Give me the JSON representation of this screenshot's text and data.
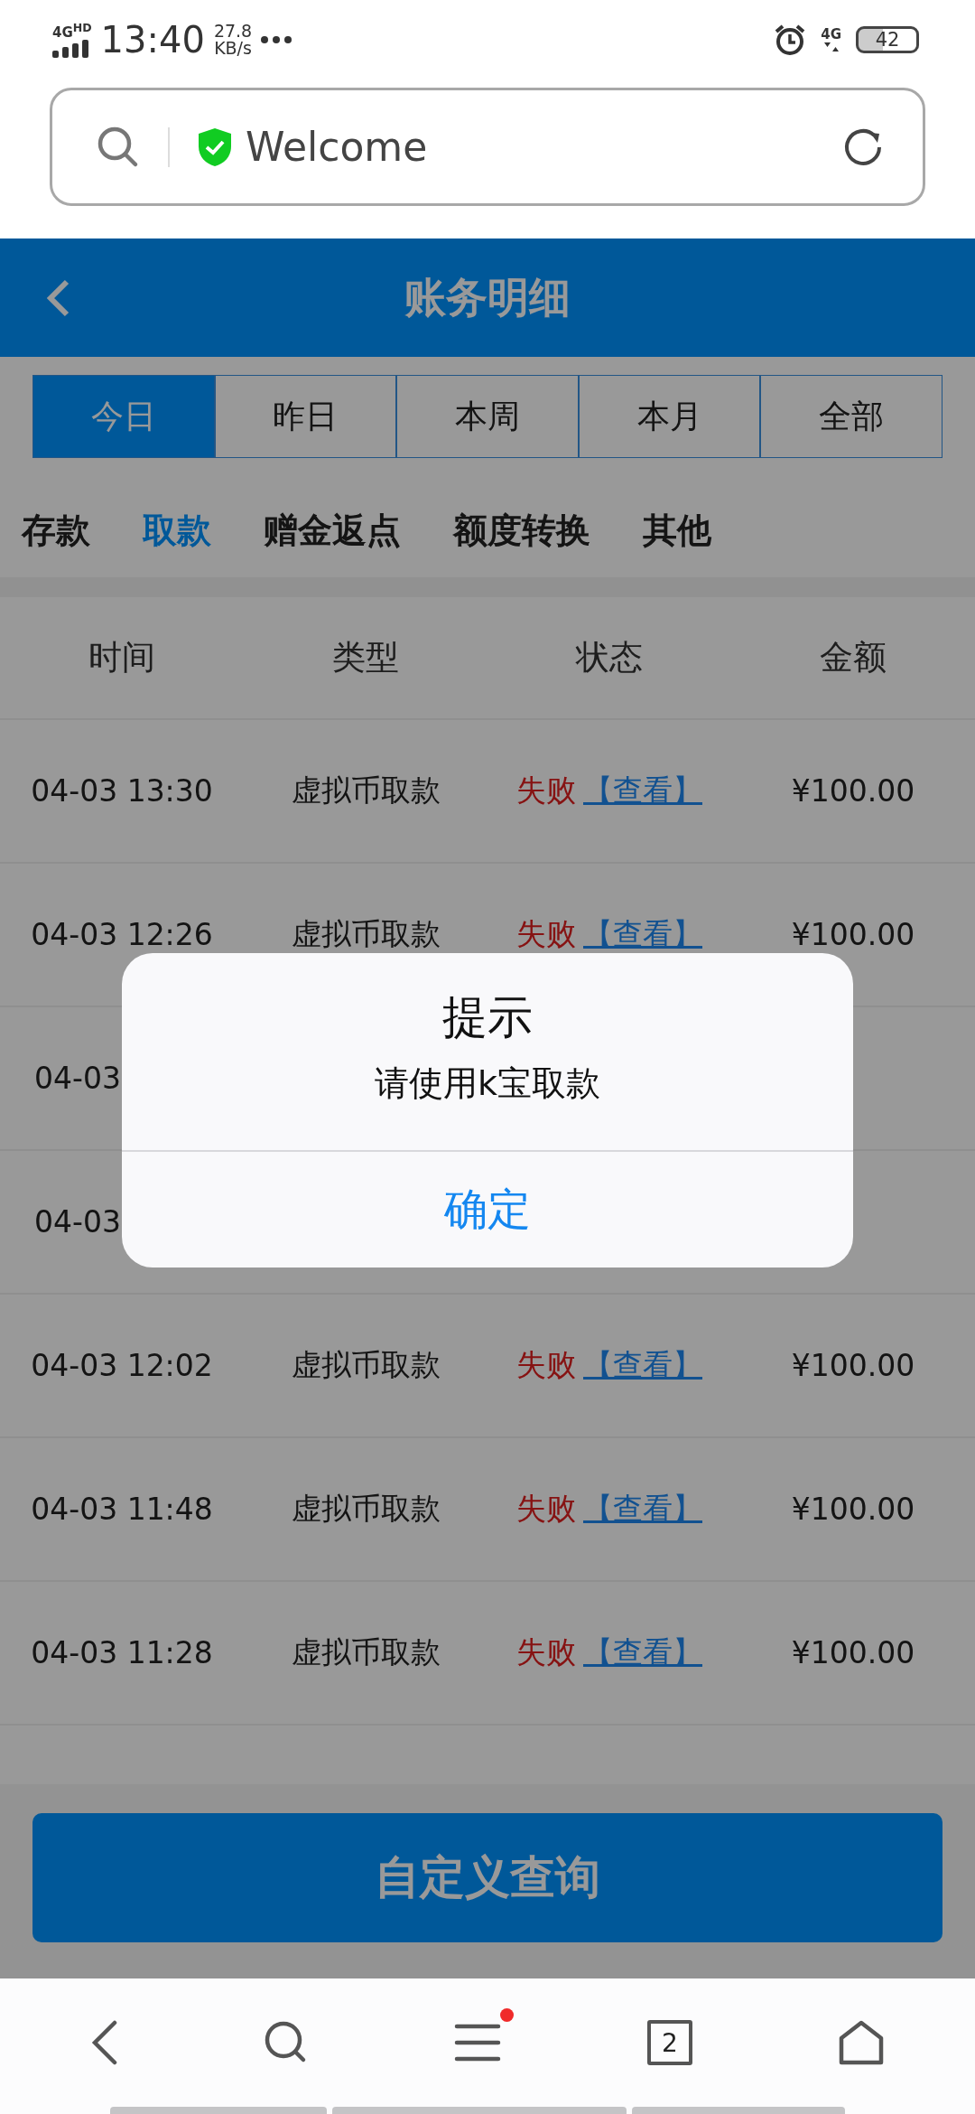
{
  "status_bar": {
    "network": "4G",
    "network_badge": "HD",
    "time": "13:40",
    "speed": "27.8",
    "speed_unit": "KB/s",
    "network_right": "4G",
    "battery": "42"
  },
  "address_bar": {
    "text": "Welcome"
  },
  "header": {
    "title": "账务明细"
  },
  "period_tabs": [
    {
      "label": "今日",
      "selected": true
    },
    {
      "label": "昨日",
      "selected": false
    },
    {
      "label": "本周",
      "selected": false
    },
    {
      "label": "本月",
      "selected": false
    },
    {
      "label": "全部",
      "selected": false
    }
  ],
  "category_tabs": [
    {
      "label": "存款",
      "selected": false
    },
    {
      "label": "取款",
      "selected": true
    },
    {
      "label": "赠金返点",
      "selected": false
    },
    {
      "label": "额度转换",
      "selected": false
    },
    {
      "label": "其他",
      "selected": false
    }
  ],
  "table": {
    "columns": [
      "时间",
      "类型",
      "状态",
      "金额"
    ],
    "rows": [
      {
        "time": "04-03 13:30",
        "type": "虚拟币取款",
        "status": "失败",
        "link": "【查看】",
        "amount": "¥100.00"
      },
      {
        "time": "04-03 12:26",
        "type": "虚拟币取款",
        "status": "失败",
        "link": "【查看】",
        "amount": "¥100.00"
      },
      {
        "time": "04-03"
      },
      {
        "time": "04-03"
      },
      {
        "time": "04-03 12:02",
        "type": "虚拟币取款",
        "status": "失败",
        "link": "【查看】",
        "amount": "¥100.00"
      },
      {
        "time": "04-03 11:48",
        "type": "虚拟币取款",
        "status": "失败",
        "link": "【查看】",
        "amount": "¥100.00"
      },
      {
        "time": "04-03 11:28",
        "type": "虚拟币取款",
        "status": "失败",
        "link": "【查看】",
        "amount": "¥100.00"
      }
    ]
  },
  "query_button": "自定义查询",
  "dialog": {
    "title": "提示",
    "message": "请使用k宝取款",
    "button": "确定"
  },
  "bottom_nav": {
    "tab_count": "2",
    "menu_badge": true
  }
}
